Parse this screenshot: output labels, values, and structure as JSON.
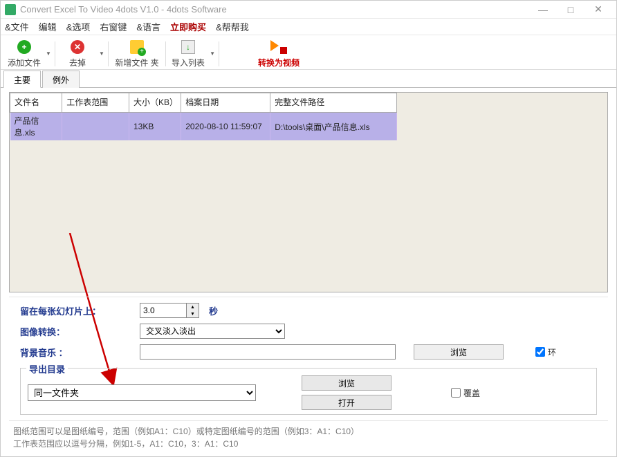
{
  "window": {
    "title": "Convert Excel To Video 4dots V1.0 - 4dots Software"
  },
  "menu": {
    "file": "&文件",
    "edit": "编辑",
    "options": "&选项",
    "rightkey": "右窗键",
    "lang": "&语言",
    "buy": "立即购买",
    "help": "&帮帮我"
  },
  "toolbar": {
    "add": "添加文件",
    "remove": "去掉",
    "newfolder": "新增文件 夹",
    "importlist": "导入列表",
    "convert": "转换为视频"
  },
  "tabs": {
    "main": "主要",
    "except": "例外"
  },
  "table": {
    "headers": {
      "filename": "文件名",
      "worksheet": "工作表范围",
      "size": "大小（KB）",
      "date": "档案日期",
      "path": "完整文件路径"
    },
    "rows": [
      {
        "filename": "产品信息.xls",
        "worksheet": "",
        "size": "13KB",
        "date": "2020-08-10 11:59:07",
        "path": "D:\\tools\\桌面\\产品信息.xls"
      }
    ]
  },
  "form": {
    "stay_label": "留在每张幻灯片上：",
    "stay_value": "3.0",
    "stay_unit": "秒",
    "transition_label": "图像转换：",
    "transition_value": "交叉淡入淡出",
    "bgm_label": "背景音乐 ：",
    "bgm_value": "",
    "browse": "浏览",
    "loop": "环"
  },
  "export": {
    "legend": "导出目录",
    "folder": "同一文件夹",
    "browse": "浏览",
    "open": "打开",
    "overwrite": "覆盖"
  },
  "hint": {
    "l1": "图纸范围可以是图纸编号，范围（例如A1：C10）或特定图纸编号的范围（例如3：A1：C10）",
    "l2": "工作表范围应以逗号分隔，例如1-5，A1：C10，3：A1：C10"
  }
}
